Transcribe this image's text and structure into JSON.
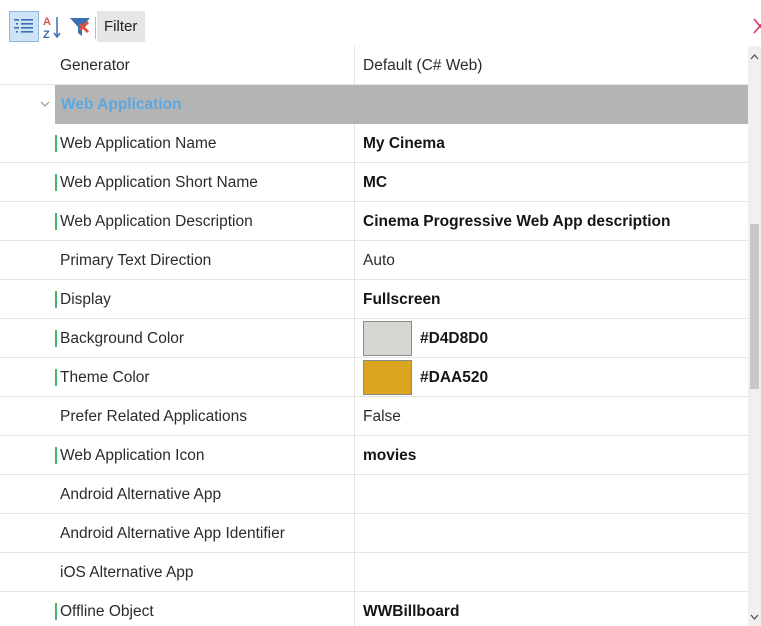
{
  "toolbar": {
    "filter_label": "Filter",
    "filter_value": "",
    "icons": {
      "categorized": "categorized-view-icon",
      "alphabetical": "sort-az-icon",
      "filter": "filter-icon",
      "clear": "clear-filter-icon"
    }
  },
  "colors": {
    "accent": "#DAA520",
    "category_bar": "#B4B4B4",
    "category_text": "#5BA8E0",
    "modified_marker": "#47B36B"
  },
  "rows": [
    {
      "name": "Generator",
      "value": "Default (C# Web)",
      "modified": false,
      "bold": false
    },
    {
      "category": "Web Application"
    },
    {
      "name": "Web Application Name",
      "value": "My Cinema",
      "modified": true,
      "bold": true
    },
    {
      "name": "Web Application Short Name",
      "value": "MC",
      "modified": true,
      "bold": true
    },
    {
      "name": "Web Application Description",
      "value": "Cinema Progressive Web App description",
      "modified": true,
      "bold": true
    },
    {
      "name": "Primary Text Direction",
      "value": "Auto",
      "modified": false,
      "bold": false
    },
    {
      "name": "Display",
      "value": "Fullscreen",
      "modified": true,
      "bold": true
    },
    {
      "name": "Background Color",
      "value": "#D4D8D0",
      "swatch": "#D4D8D0",
      "modified": true,
      "bold": true
    },
    {
      "name": "Theme Color",
      "value": "#DAA520",
      "swatch": "#DAA520",
      "modified": true,
      "bold": true
    },
    {
      "name": "Prefer Related Applications",
      "value": "False",
      "modified": false,
      "bold": false
    },
    {
      "name": "Web Application Icon",
      "value": "movies",
      "modified": true,
      "bold": true
    },
    {
      "name": "Android Alternative App",
      "value": "",
      "modified": false,
      "bold": false
    },
    {
      "name": "Android Alternative App Identifier",
      "value": "",
      "modified": false,
      "bold": false
    },
    {
      "name": "iOS Alternative App",
      "value": "",
      "modified": false,
      "bold": false
    },
    {
      "name": "Offline Object",
      "value": "WWBillboard",
      "modified": true,
      "bold": true
    }
  ]
}
